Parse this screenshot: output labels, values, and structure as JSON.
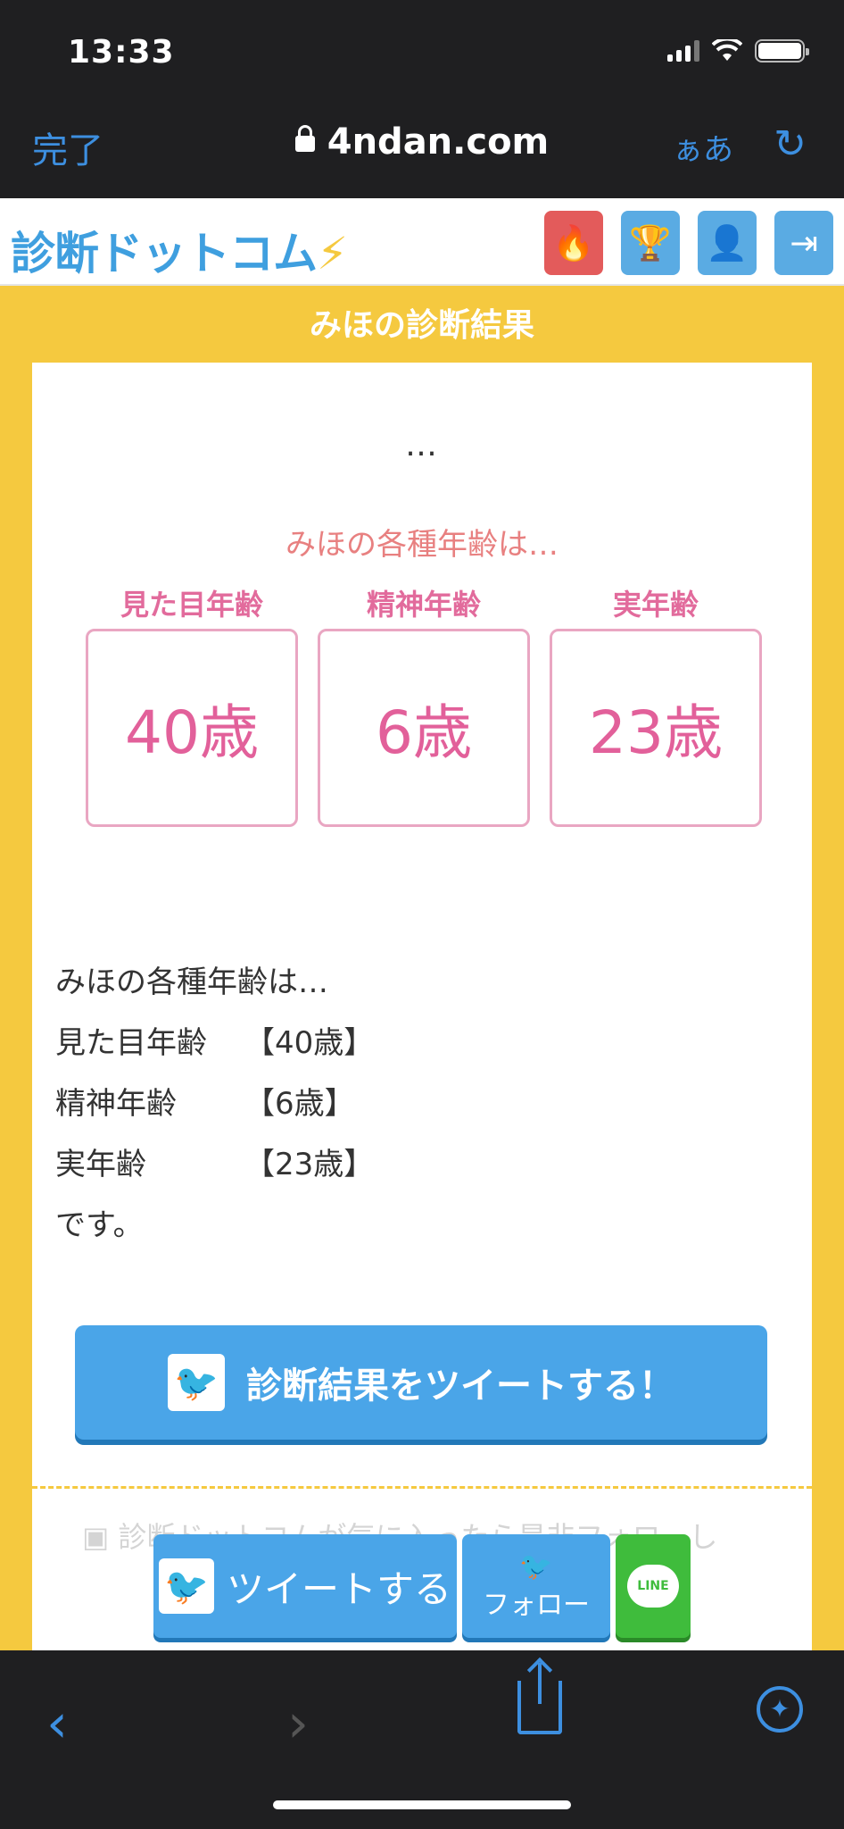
{
  "status": {
    "time": "13:33"
  },
  "browser": {
    "done": "完了",
    "url": "4ndan.com",
    "aa": "ぁあ",
    "reload_icon": "reload-icon"
  },
  "site": {
    "logo": "診断ドットコム",
    "logo_bolt": "⚡"
  },
  "header_buttons": [
    {
      "icon": "flame-icon",
      "glyph": "🔥"
    },
    {
      "icon": "trophy-icon",
      "glyph": "🏆"
    },
    {
      "icon": "person-icon",
      "glyph": "👤"
    },
    {
      "icon": "login-icon",
      "glyph": "⇥"
    }
  ],
  "result": {
    "title": "みほの診断結果",
    "dots": "…",
    "age_intro": "みほの各種年齢は…",
    "ages": [
      {
        "label": "見た目年齢",
        "value": "40歳"
      },
      {
        "label": "精神年齢",
        "value": "6歳"
      },
      {
        "label": "実年齢",
        "value": "23歳"
      }
    ],
    "text_intro": "みほの各種年齢は…",
    "text_rows": [
      {
        "key": "見た目年齢",
        "value": "【40歳】"
      },
      {
        "key": "精神年齢",
        "value": "【6歳】"
      },
      {
        "key": "実年齢",
        "value": "【23歳】"
      }
    ],
    "text_outro": "です。"
  },
  "actions": {
    "tweet_result": "診断結果をツイートする！",
    "follow_note": "診断ドットコムが気に入ったら是非フォローし"
  },
  "share_bar": {
    "tweet": "ツイートする",
    "follow": "フォロー",
    "line": "LINE"
  },
  "colors": {
    "brand_blue": "#4aa5e8",
    "yellow": "#f5c93f",
    "pink": "#e2609a",
    "line_green": "#3fbc3c"
  }
}
